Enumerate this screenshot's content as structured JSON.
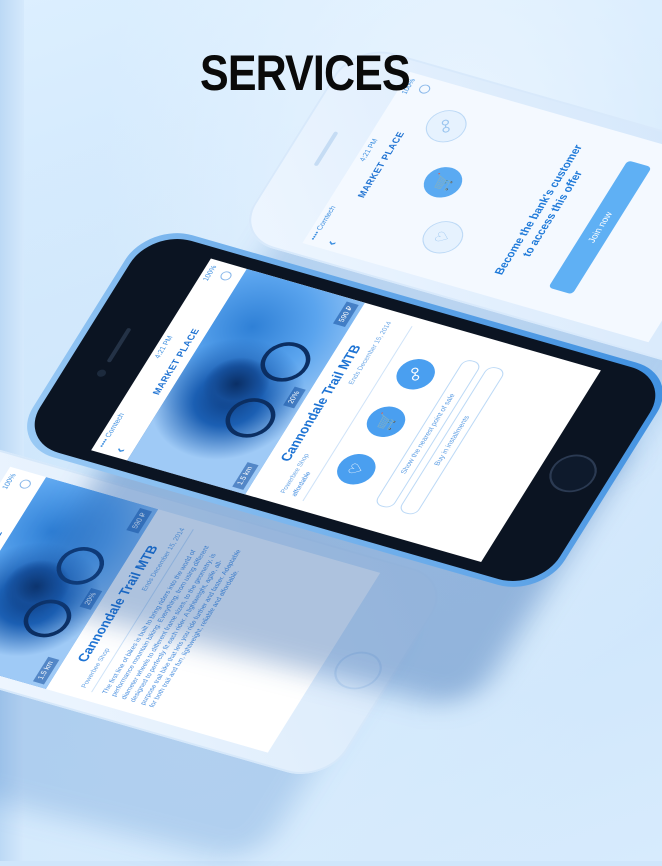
{
  "page": {
    "title": "SERVICES"
  },
  "status_bar": {
    "carrier": "•••• Comtech",
    "time": "4:21 PM",
    "battery": "100%"
  },
  "nav": {
    "title": "MARKET PLACE",
    "back_icon": "chevron-left-icon",
    "search_icon": "search-icon"
  },
  "product": {
    "name": "Cannondale Trail MTB",
    "distance": "1.5 km",
    "discount": "20%",
    "price": "590 ₽",
    "shop": "Powerbee Shop",
    "ends": "Ends December 15, 2014",
    "note": "affordable",
    "description": "The first line of bikes is built to bring riders into the world of performance mountain biking. Everything, from using different diameter wheels to different frame sizes, to the geometry, is designed to perfectly fit each rider. A lightweight, agile, all-purpose trail bike that lets you ride further and faster. Adaptable for both trail and fun, lightweight, reliable and affordable."
  },
  "actions": {
    "like_icon": "heart-icon",
    "cart_icon": "cart-icon",
    "share_icon": "share-icon",
    "nearest_point_label": "Show the nearest point of sale",
    "installments_label": "Buy in installments"
  },
  "offer": {
    "message_line1": "Become the bank's customer",
    "message_line2": "to access this offer",
    "join_label": "Join now"
  },
  "colors": {
    "accent": "#1e72d2",
    "button": "#4a9ff0",
    "background": "#cfe6fb"
  }
}
